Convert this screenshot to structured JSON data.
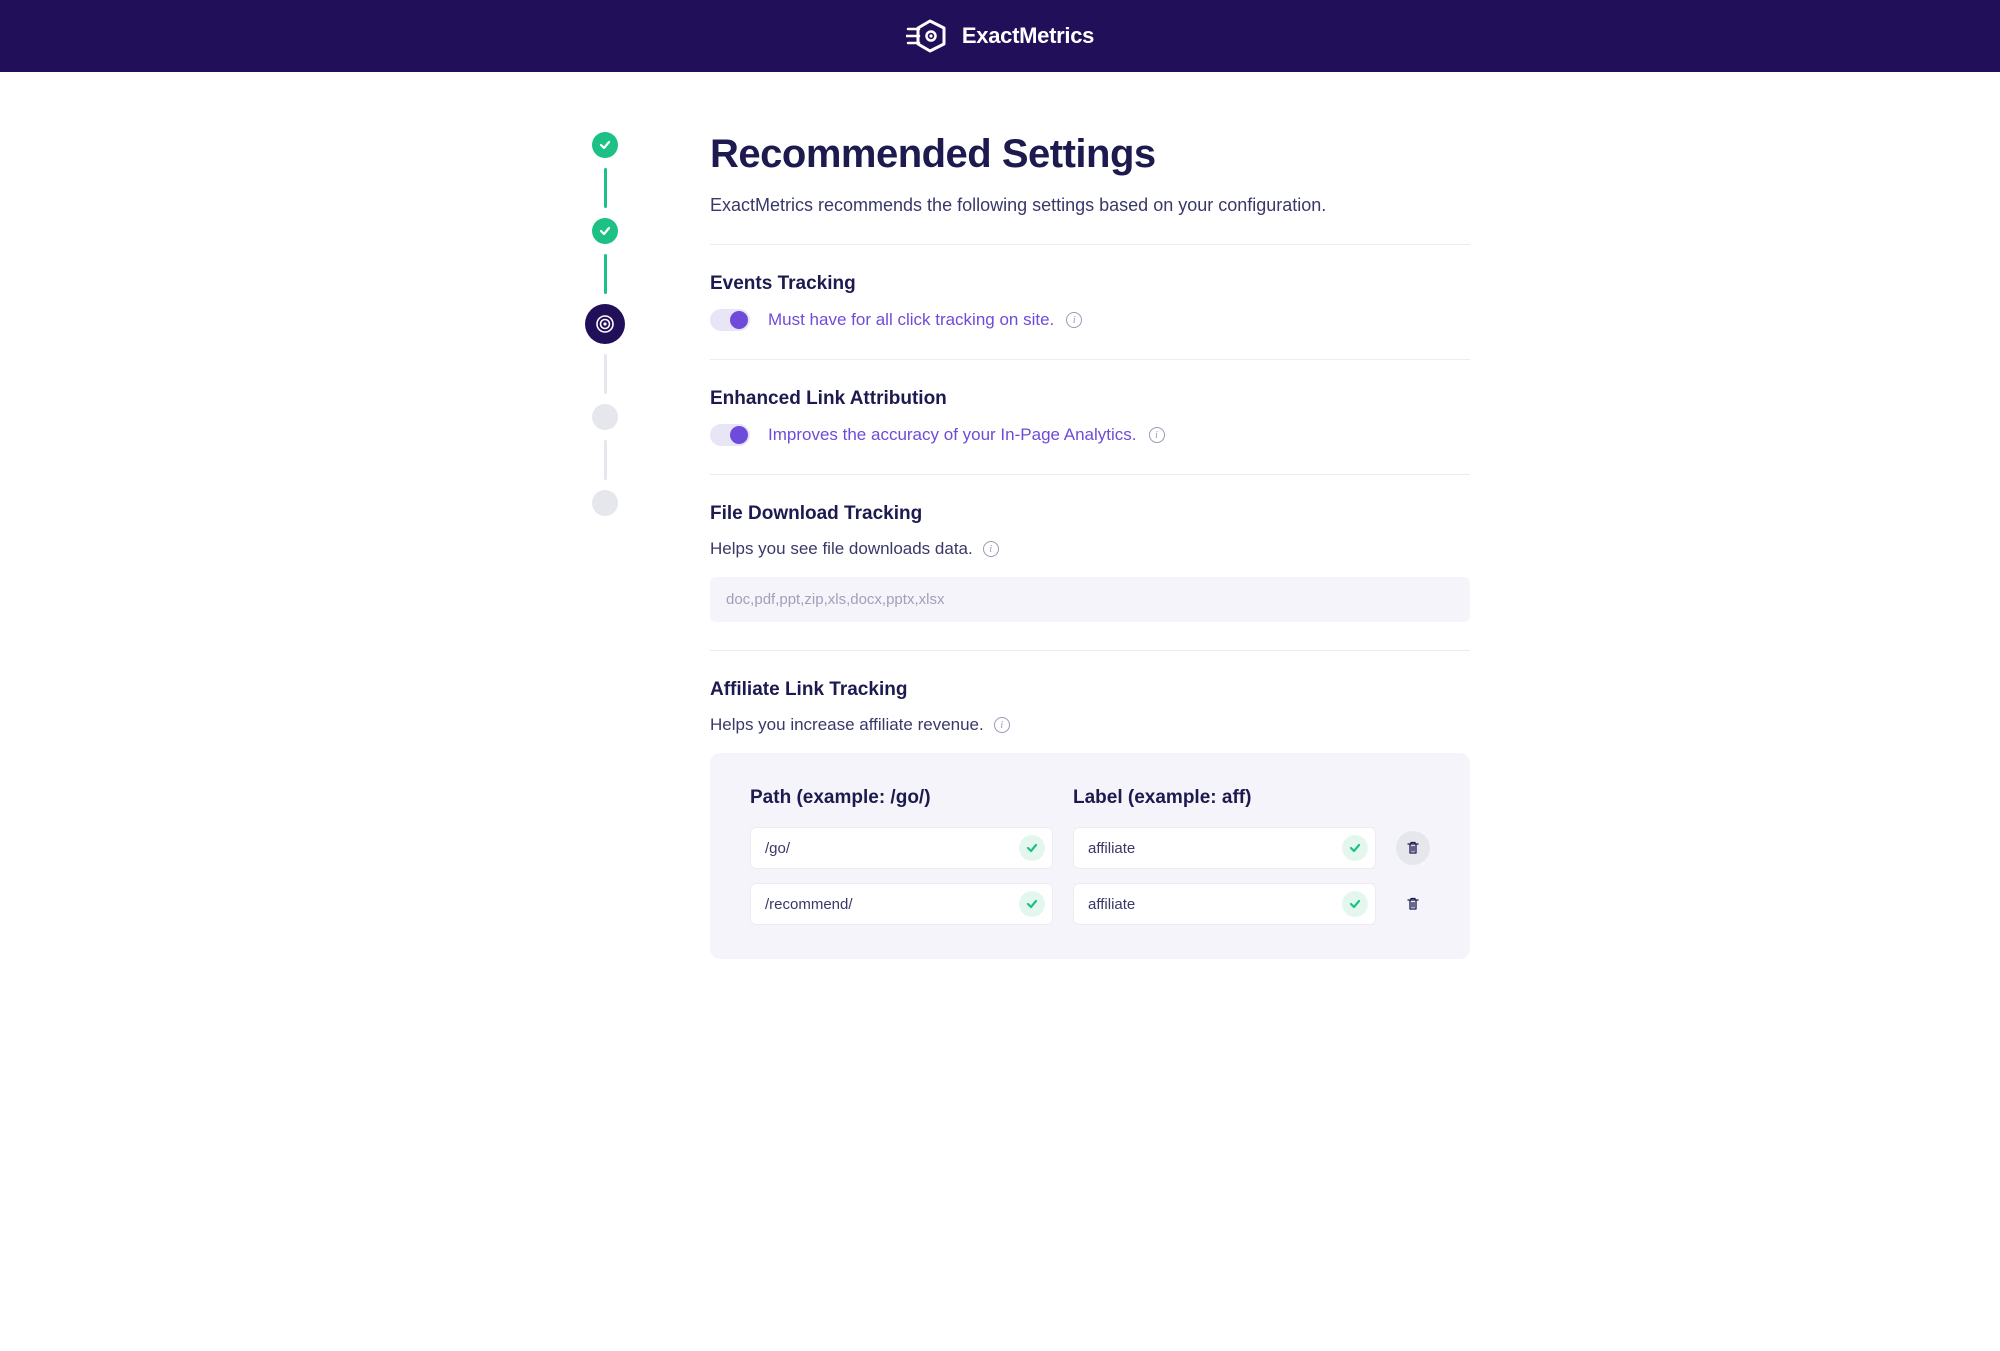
{
  "brand": {
    "name": "ExactMetrics"
  },
  "page": {
    "title": "Recommended Settings",
    "subtitle": "ExactMetrics recommends the following settings based on your configuration."
  },
  "stepper": {
    "steps": [
      {
        "state": "done"
      },
      {
        "state": "done"
      },
      {
        "state": "current"
      },
      {
        "state": "future"
      },
      {
        "state": "future"
      }
    ]
  },
  "sections": {
    "events": {
      "title": "Events Tracking",
      "toggle_on": true,
      "desc": "Must have for all click tracking on site."
    },
    "enhanced": {
      "title": "Enhanced Link Attribution",
      "toggle_on": true,
      "desc": "Improves the accuracy of your In-Page Analytics."
    },
    "filedl": {
      "title": "File Download Tracking",
      "sub": "Helps you see file downloads data.",
      "extensions": "doc,pdf,ppt,zip,xls,docx,pptx,xlsx"
    },
    "affiliate": {
      "title": "Affiliate Link Tracking",
      "sub": "Helps you increase affiliate revenue.",
      "path_header": "Path (example: /go/)",
      "label_header": "Label (example: aff)",
      "rows": [
        {
          "path": "/go/",
          "label": "affiliate"
        },
        {
          "path": "/recommend/",
          "label": "affiliate"
        }
      ]
    }
  }
}
